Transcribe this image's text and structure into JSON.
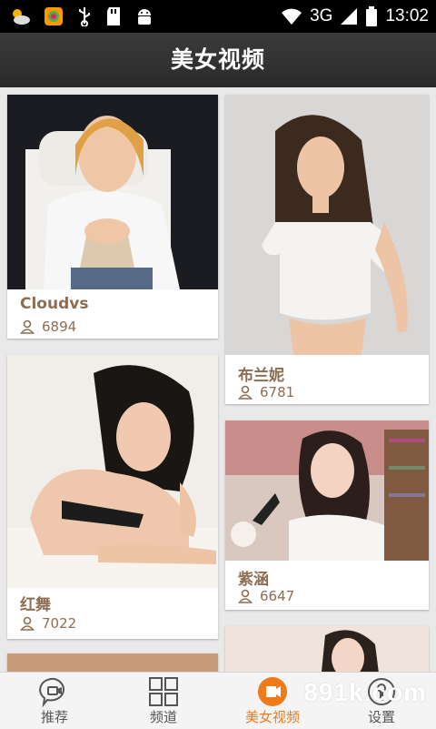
{
  "status_bar": {
    "network": "3G",
    "time": "13:02",
    "icons": [
      "weather-icon",
      "app-store-icon",
      "usb-icon",
      "sd-card-icon",
      "android-icon",
      "wifi-icon",
      "signal-icon",
      "battery-icon"
    ]
  },
  "header": {
    "title": "美女视频"
  },
  "cards": [
    {
      "name": "Cloudvs",
      "views": "6894"
    },
    {
      "name": "布兰妮",
      "views": "6781"
    },
    {
      "name": "红舞",
      "views": "7022"
    },
    {
      "name": "紫涵",
      "views": "6647"
    }
  ],
  "bottom_nav": {
    "items": [
      {
        "label": "推荐",
        "icon": "chat-icon",
        "active": false
      },
      {
        "label": "频道",
        "icon": "grid-icon",
        "active": false
      },
      {
        "label": "美女视频",
        "icon": "video-icon",
        "active": true
      },
      {
        "label": "设置",
        "icon": "settings-icon",
        "active": false
      }
    ]
  },
  "watermark": "891k.com",
  "colors": {
    "accent": "#f07a1a",
    "name_text": "#8d6e53",
    "header_bg": "#333333"
  }
}
